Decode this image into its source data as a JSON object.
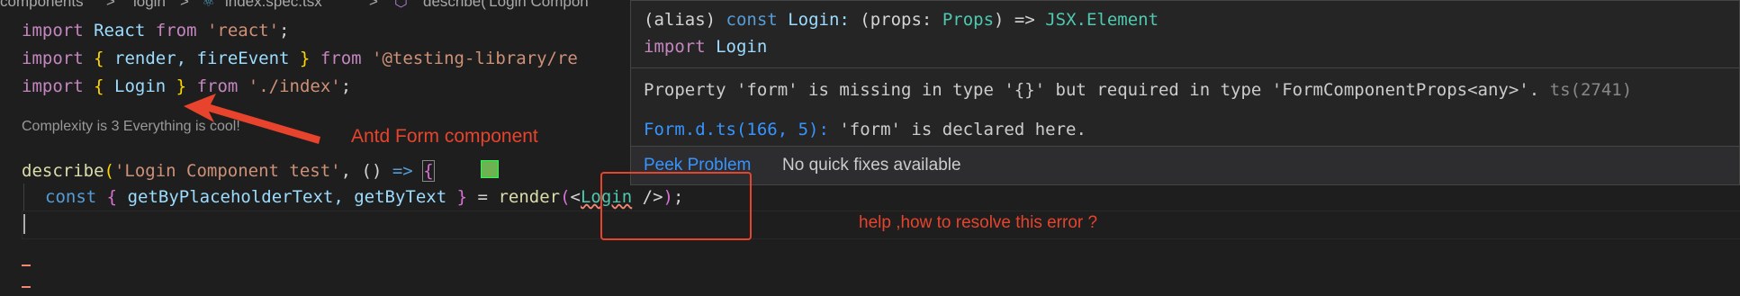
{
  "breadcrumb": {
    "segment1": "components",
    "segment2": "login",
    "file": "index.spec.tsx",
    "symbol": "describe('Login Compon"
  },
  "code": {
    "line1": [
      "import",
      "React",
      "from",
      "'react'",
      ";"
    ],
    "line2": [
      "import",
      "{",
      "render, fireEvent",
      "}",
      "from",
      "'@testing-library/re"
    ],
    "line3": [
      "import",
      "{",
      "Login",
      "}",
      "from",
      "'./index'",
      ";"
    ],
    "codelens": "Complexity is 3 Everything is cool!",
    "line5": [
      "describe",
      "(",
      "'Login Component test'",
      ", () ",
      "=>",
      "{"
    ],
    "line6": [
      "const",
      "{",
      "getByPlaceholderText, getByText",
      "}",
      "=",
      "render",
      "(",
      "<",
      "Login",
      "/>",
      ")",
      ";"
    ]
  },
  "hover": {
    "sig_alias": "(alias)",
    "sig_const": "const",
    "sig_name": "Login:",
    "sig_props": "(props:",
    "sig_type": "Props",
    "sig_arrow": ") =>",
    "sig_ret": "JSX.Element",
    "import_kw": "import",
    "import_name": "Login",
    "error_msg": "Property 'form' is missing in type '{}' but required in type 'FormComponentProps<any>'.",
    "error_code": "ts(2741)",
    "related_loc": "Form.d.ts(166, 5):",
    "related_msg": "'form' is declared here.",
    "peek_label": "Peek Problem",
    "no_fix_label": "No quick fixes available"
  },
  "annotations": {
    "arrow_label": "Antd Form component",
    "question": "help ,how to resolve this error ?"
  },
  "colors": {
    "annotation": "#e8432c",
    "link": "#3794ff"
  }
}
